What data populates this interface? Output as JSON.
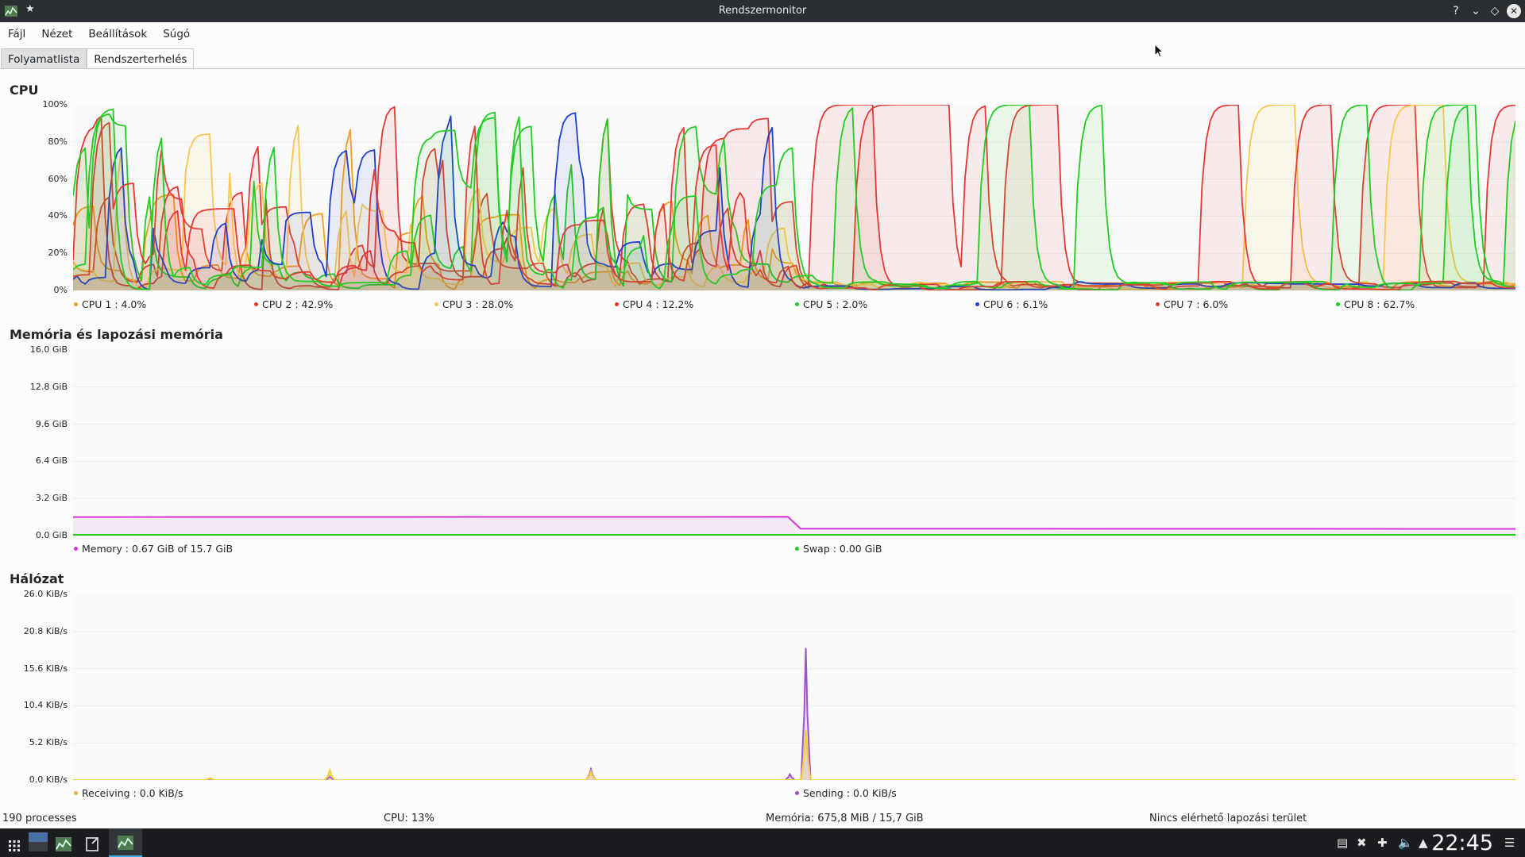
{
  "window": {
    "title": "Rendszermonitor"
  },
  "menu": [
    "Fájl",
    "Nézet",
    "Beállítások",
    "Súgó"
  ],
  "tabs": [
    {
      "label": "Folyamatlista",
      "active": false
    },
    {
      "label": "Rendszerterhelés",
      "active": true
    }
  ],
  "sections": {
    "cpu": {
      "title": "CPU",
      "yticks": [
        "100%",
        "80%",
        "60%",
        "40%",
        "20%",
        "0%"
      ],
      "legend": [
        {
          "label": "CPU 1 : 4.0%",
          "color": "#f59e1c"
        },
        {
          "label": "CPU 2 : 42.9%",
          "color": "#e53935"
        },
        {
          "label": "CPU 3 : 28.0%",
          "color": "#f9c74f"
        },
        {
          "label": "CPU 4 : 12.2%",
          "color": "#e53935"
        },
        {
          "label": "CPU 5 : 2.0%",
          "color": "#22cc22"
        },
        {
          "label": "CPU 6 : 6.1%",
          "color": "#1f3fcf"
        },
        {
          "label": "CPU 7 : 6.0%",
          "color": "#e53935"
        },
        {
          "label": "CPU 8 : 62.7%",
          "color": "#22cc22"
        }
      ]
    },
    "memory": {
      "title": "Memória és lapozási memória",
      "yticks": [
        "16.0 GiB",
        "12.8 GiB",
        "9.6 GiB",
        "6.4 GiB",
        "3.2 GiB",
        "0.0 GiB"
      ],
      "legend": [
        {
          "label": "Memory : 0.67 GiB of 15.7 GiB",
          "color": "#d633d6"
        },
        {
          "label": "Swap : 0.00 GiB",
          "color": "#22cc22"
        }
      ]
    },
    "network": {
      "title": "Hálózat",
      "yticks": [
        "26.0 KiB/s",
        "20.8 KiB/s",
        "15.6 KiB/s",
        "10.4 KiB/s",
        "5.2 KiB/s",
        "0.0 KiB/s"
      ],
      "legend": [
        {
          "label": "Receiving : 0.0 KiB/s",
          "color": "#e0b43a"
        },
        {
          "label": "Sending : 0.0 KiB/s",
          "color": "#a050d0"
        }
      ]
    }
  },
  "chart_data": [
    {
      "type": "line",
      "title": "CPU",
      "ylim": [
        0,
        100
      ],
      "series": [
        {
          "name": "CPU 1",
          "current": 4.0
        },
        {
          "name": "CPU 2",
          "current": 42.9
        },
        {
          "name": "CPU 3",
          "current": 28.0
        },
        {
          "name": "CPU 4",
          "current": 12.2
        },
        {
          "name": "CPU 5",
          "current": 2.0
        },
        {
          "name": "CPU 6",
          "current": 6.1
        },
        {
          "name": "CPU 7",
          "current": 6.0
        },
        {
          "name": "CPU 8",
          "current": 62.7
        }
      ]
    },
    {
      "type": "area",
      "title": "Memória és lapozási memória",
      "ylim": [
        0,
        16.0
      ],
      "series": [
        {
          "name": "Memory",
          "values": [
            1.6,
            1.6,
            1.6,
            1.6,
            0.6,
            0.6,
            0.6,
            0.6
          ]
        },
        {
          "name": "Swap",
          "values": [
            0,
            0,
            0,
            0,
            0,
            0,
            0,
            0
          ]
        }
      ]
    },
    {
      "type": "area",
      "title": "Hálózat",
      "ylim": [
        0,
        26.0
      ],
      "series": [
        {
          "name": "Receiving",
          "peaks": [
            0.3,
            1.4,
            1.2,
            7.0
          ]
        },
        {
          "name": "Sending",
          "peaks": [
            0.2,
            0.5,
            1.5,
            18.5
          ]
        }
      ]
    }
  ],
  "status": {
    "processes": "190 processes",
    "cpu": "CPU: 13%",
    "memory": "Memória: 675,8 MiB / 15,7 GiB",
    "swap": "Nincs elérhető lapozási terület"
  },
  "clock": "22:45"
}
